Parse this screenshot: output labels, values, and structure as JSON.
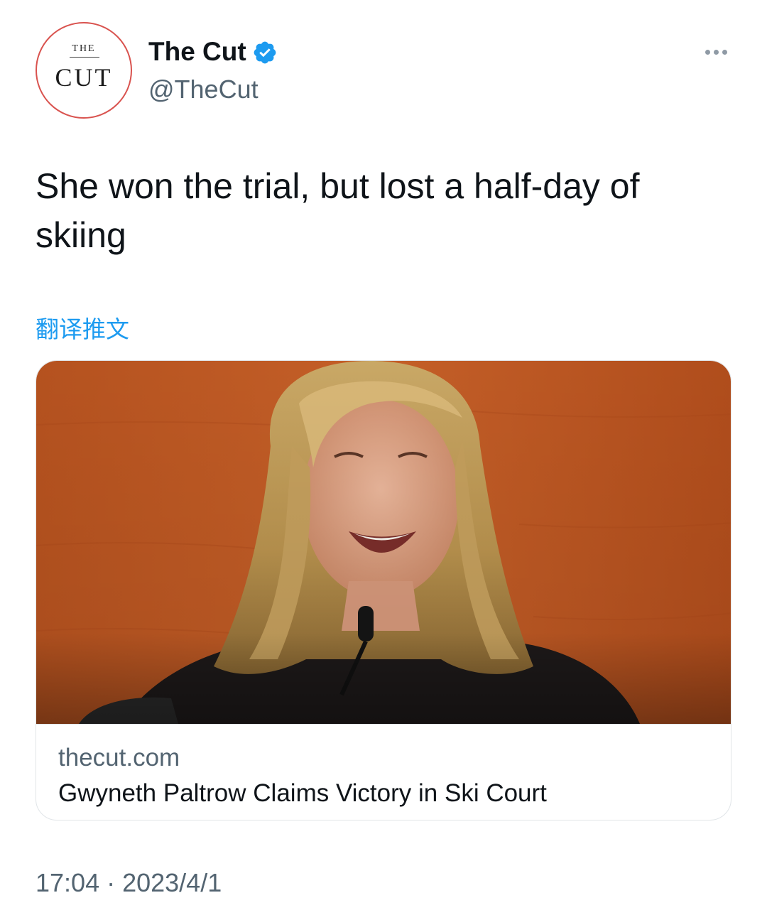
{
  "account": {
    "avatar_top": "THE",
    "avatar_main": "CUT",
    "display_name": "The Cut",
    "handle": "@TheCut",
    "verified": true
  },
  "tweet": {
    "text": "She won the trial, but lost a half-day of skiing",
    "translate_label": "翻译推文"
  },
  "card": {
    "image_icon": "photo-of-smiling-woman-at-microphone",
    "domain": "thecut.com",
    "title": "Gwyneth Paltrow Claims Victory in Ski Court"
  },
  "meta": {
    "time": "17:04",
    "separator": "·",
    "date": "2023/4/1"
  },
  "colors": {
    "link_blue": "#1d9bf0",
    "secondary_text": "#536471",
    "avatar_ring": "#d9534f",
    "verified_badge": "#1d9bf0"
  }
}
